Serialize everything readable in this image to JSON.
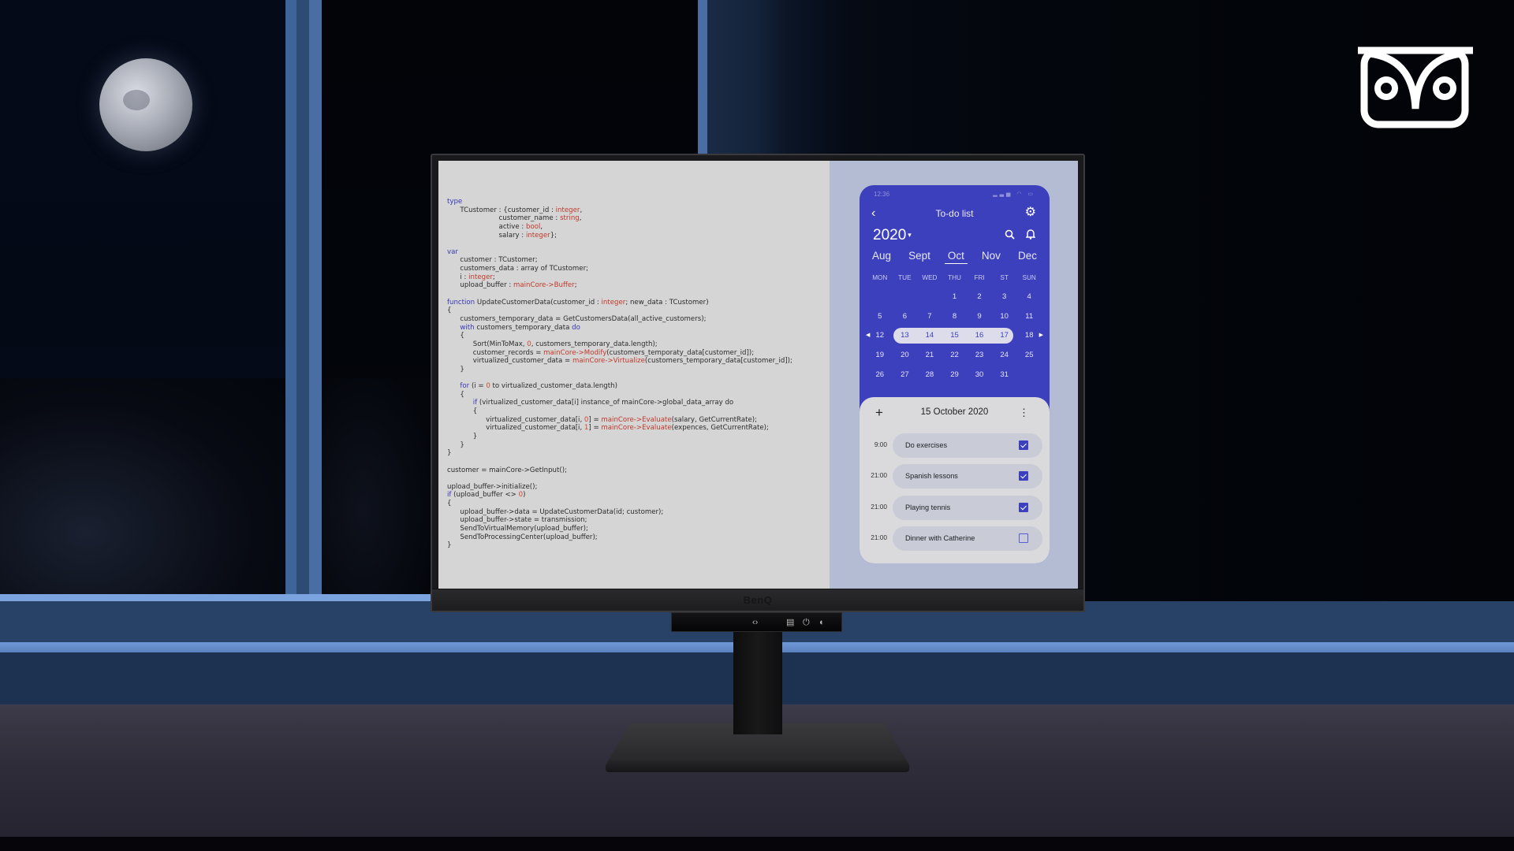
{
  "brand": {
    "monitor_logo": "BenQ",
    "corner_logo": "owl-logo"
  },
  "monitor_buttons": [
    "input-switch-icon",
    "menu-icon",
    "power-icon",
    "eye-care-icon"
  ],
  "code_editor": {
    "lines": [
      [
        {
          "t": "type",
          "c": "kw"
        }
      ],
      [
        {
          "t": "      TCustomer : {customer_id : "
        },
        {
          "t": "integer",
          "c": "ty"
        },
        {
          "t": ","
        }
      ],
      [
        {
          "t": "                        customer_name : "
        },
        {
          "t": "string",
          "c": "ty"
        },
        {
          "t": ","
        }
      ],
      [
        {
          "t": "                        active : "
        },
        {
          "t": "bool",
          "c": "ty"
        },
        {
          "t": ","
        }
      ],
      [
        {
          "t": "                        salary : "
        },
        {
          "t": "integer",
          "c": "ty"
        },
        {
          "t": "};"
        }
      ],
      [
        {
          "t": ""
        }
      ],
      [
        {
          "t": "var",
          "c": "kw"
        }
      ],
      [
        {
          "t": "      customer : TCustomer;"
        }
      ],
      [
        {
          "t": "      customers_data : array of TCustomer;"
        }
      ],
      [
        {
          "t": "      i : "
        },
        {
          "t": "integer",
          "c": "ty"
        },
        {
          "t": ";"
        }
      ],
      [
        {
          "t": "      upload_buffer : "
        },
        {
          "t": "mainCore->Buffer",
          "c": "ty"
        },
        {
          "t": ";"
        }
      ],
      [
        {
          "t": ""
        }
      ],
      [
        {
          "t": "function",
          "c": "kw"
        },
        {
          "t": " UpdateCustomerData(customer_id : "
        },
        {
          "t": "integer",
          "c": "ty"
        },
        {
          "t": "; new_data : TCustomer)"
        }
      ],
      [
        {
          "t": "{"
        }
      ],
      [
        {
          "t": "      customers_temporary_data = GetCustomersData(all_active_customers);"
        }
      ],
      [
        {
          "t": "      "
        },
        {
          "t": "with",
          "c": "kw"
        },
        {
          "t": " customers_temporary_data "
        },
        {
          "t": "do",
          "c": "kw"
        }
      ],
      [
        {
          "t": "      {"
        }
      ],
      [
        {
          "t": "            Sort(MinToMax, "
        },
        {
          "t": "0",
          "c": "num"
        },
        {
          "t": ", customers_temporary_data.length);"
        }
      ],
      [
        {
          "t": "            customer_records = "
        },
        {
          "t": "mainCore->Modify",
          "c": "ty"
        },
        {
          "t": "(customers_temporaty_data[customer_id]);"
        }
      ],
      [
        {
          "t": "            virtualized_customer_data = "
        },
        {
          "t": "mainCore->Virtualize",
          "c": "ty"
        },
        {
          "t": "(customers_temporary_data[customer_id]);"
        }
      ],
      [
        {
          "t": "      }"
        }
      ],
      [
        {
          "t": ""
        }
      ],
      [
        {
          "t": "      "
        },
        {
          "t": "for",
          "c": "kw"
        },
        {
          "t": " (i = "
        },
        {
          "t": "0",
          "c": "num"
        },
        {
          "t": " to virtualized_customer_data.length)"
        }
      ],
      [
        {
          "t": "      {"
        }
      ],
      [
        {
          "t": "            "
        },
        {
          "t": "if",
          "c": "kw"
        },
        {
          "t": " (virtualized_customer_data[i] instance_of mainCore->global_data_array do"
        }
      ],
      [
        {
          "t": "            {"
        }
      ],
      [
        {
          "t": "                  virtualized_customer_data[i, "
        },
        {
          "t": "0",
          "c": "num"
        },
        {
          "t": "] = "
        },
        {
          "t": "mainCore->Evaluate",
          "c": "ty"
        },
        {
          "t": "(salary, GetCurrentRate);"
        }
      ],
      [
        {
          "t": "                  virtualized_customer_data[i, "
        },
        {
          "t": "1",
          "c": "num"
        },
        {
          "t": "] = "
        },
        {
          "t": "mainCore->Evaluate",
          "c": "ty"
        },
        {
          "t": "(expences, GetCurrentRate);"
        }
      ],
      [
        {
          "t": "            }"
        }
      ],
      [
        {
          "t": "      }"
        }
      ],
      [
        {
          "t": "}"
        }
      ],
      [
        {
          "t": ""
        }
      ],
      [
        {
          "t": "customer = mainCore->GetInput();"
        }
      ],
      [
        {
          "t": ""
        }
      ],
      [
        {
          "t": "upload_buffer->initialize();"
        }
      ],
      [
        {
          "t": "if",
          "c": "kw"
        },
        {
          "t": " (upload_buffer <> "
        },
        {
          "t": "0",
          "c": "num"
        },
        {
          "t": ")"
        }
      ],
      [
        {
          "t": "{"
        }
      ],
      [
        {
          "t": "      upload_buffer->data = UpdateCustomerData(id; customer);"
        }
      ],
      [
        {
          "t": "      upload_buffer->state = transmission;"
        }
      ],
      [
        {
          "t": "      SendToVirtualMemory(upload_buffer);"
        }
      ],
      [
        {
          "t": "      SendToProcessingCenter(upload_buffer);"
        }
      ],
      [
        {
          "t": "}"
        }
      ]
    ]
  },
  "phone": {
    "status_time": "12:36",
    "status_icons": "▂▃▅ ◠ ▭",
    "title": "To-do list",
    "back_icon": "‹",
    "settings_icon": "⚙",
    "year": "2020",
    "year_caret": "▾",
    "months": [
      {
        "label": "Aug",
        "active": false
      },
      {
        "label": "Sept",
        "active": false
      },
      {
        "label": "Oct",
        "active": true
      },
      {
        "label": "Nov",
        "active": false
      },
      {
        "label": "Dec",
        "active": false
      }
    ],
    "weekdays": [
      "MON",
      "TUE",
      "WED",
      "THU",
      "FRI",
      "ST",
      "SUN"
    ],
    "calendar_weeks": [
      [
        "",
        "",
        "",
        "1",
        "2",
        "3",
        "4"
      ],
      [
        "5",
        "6",
        "7",
        "8",
        "9",
        "10",
        "11"
      ],
      [
        "12",
        "13",
        "14",
        "15",
        "16",
        "17",
        "18"
      ],
      [
        "19",
        "20",
        "21",
        "22",
        "23",
        "24",
        "25"
      ],
      [
        "26",
        "27",
        "28",
        "29",
        "30",
        "31",
        ""
      ]
    ],
    "selected_week_index": 2,
    "highlighted_days": [
      "13",
      "14",
      "15",
      "16",
      "17"
    ],
    "week_prev_icon": "◀",
    "week_next_icon": "▶",
    "selected_date": "15 October 2020",
    "add_icon": "+",
    "more_icon": "⋮",
    "tasks": [
      {
        "time": "9:00",
        "label": "Do exercises",
        "done": true
      },
      {
        "time": "21:00",
        "label": "Spanish lessons",
        "done": true
      },
      {
        "time": "21:00",
        "label": "Playing tennis",
        "done": true
      },
      {
        "time": "21:00",
        "label": "Dinner with Catherine",
        "done": false
      }
    ]
  },
  "colors": {
    "phone_accent": "#3d40bd",
    "code_keyword": "#3a35b8",
    "code_type": "#c0392b",
    "editor_bg": "#d5d5d5",
    "phone_panel_bg": "#b4bcd3"
  }
}
